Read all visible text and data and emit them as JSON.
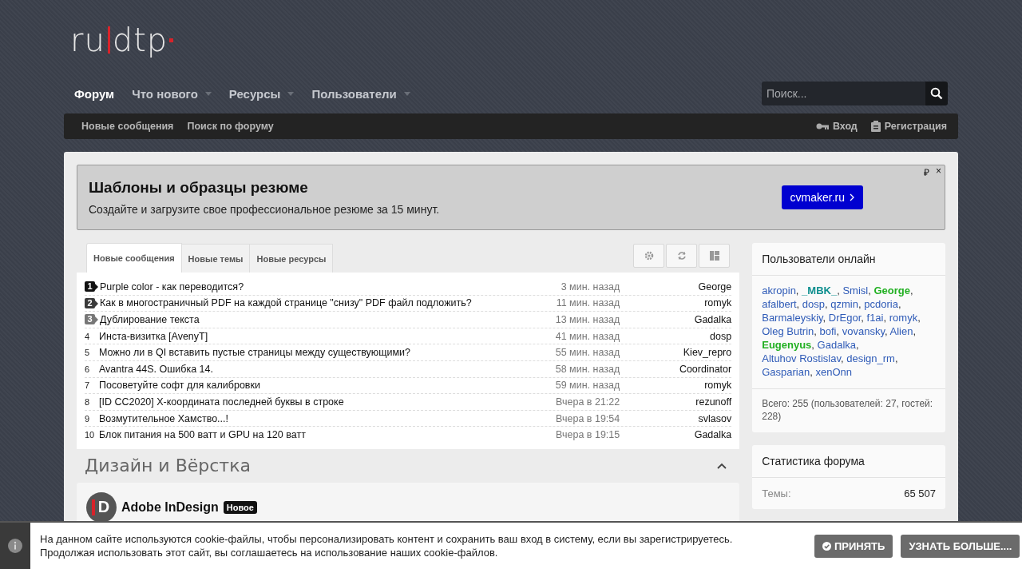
{
  "logo": {
    "left": "ru",
    "right": "dtp"
  },
  "nav": [
    {
      "label": "Форум",
      "selected": true,
      "dropdown": false
    },
    {
      "label": "Что нового",
      "selected": false,
      "dropdown": true
    },
    {
      "label": "Ресурсы",
      "selected": false,
      "dropdown": true
    },
    {
      "label": "Пользователи",
      "selected": false,
      "dropdown": true
    }
  ],
  "search": {
    "placeholder": "Поиск..."
  },
  "subnav": {
    "links": [
      "Новые сообщения",
      "Поиск по форуму"
    ],
    "login": "Вход",
    "register": "Регистрация"
  },
  "ad": {
    "title": "Шаблоны и образцы резюме",
    "text": "Создайте и загрузите свое профессиональное резюме за 15 минут.",
    "button": "cvmaker.ru",
    "mark": "₽",
    "close": "×"
  },
  "tabs": [
    {
      "label": "Новые сообщения",
      "selected": true
    },
    {
      "label": "Новые темы",
      "selected": false
    },
    {
      "label": "Новые ресурсы",
      "selected": false
    }
  ],
  "topics": [
    {
      "rank": "1",
      "kind": "ranked",
      "color": "#111111",
      "title": "Purple color - как переводится?",
      "time": "3 мин. назад",
      "user": "George"
    },
    {
      "rank": "2",
      "kind": "ranked",
      "color": "#3a3a3a",
      "title": "Как в многостраничный PDF на каждой странице \"снизу\" PDF файл подложить?",
      "time": "11 мин. назад",
      "user": "romyk"
    },
    {
      "rank": "3",
      "kind": "ranked",
      "color": "#777777",
      "title": "Дублирование текста",
      "time": "13 мин. назад",
      "user": "Gadalka"
    },
    {
      "rank": "4",
      "kind": "plain",
      "title": "Инста-визитка [AvenyT]",
      "time": "41 мин. назад",
      "user": "dosp"
    },
    {
      "rank": "5",
      "kind": "plain",
      "title": "Можно ли в QI вставить пустые страницы между существующими?",
      "time": "55 мин. назад",
      "user": "Kiev_repro"
    },
    {
      "rank": "6",
      "kind": "plain",
      "title": "Avantra 44S. Ошибка 14.",
      "time": "58 мин. назад",
      "user": "Coordinator"
    },
    {
      "rank": "7",
      "kind": "plain",
      "title": "Посоветуйте софт для калибровки",
      "time": "59 мин. назад",
      "user": "romyk"
    },
    {
      "rank": "8",
      "kind": "plain",
      "title": "[ID CC2020]  X-координата последней буквы в строке",
      "time": "Вчера в 21:22",
      "user": "rezunoff"
    },
    {
      "rank": "9",
      "kind": "plain",
      "title": "Возмутительное Хамство...!",
      "time": "Вчера в 19:54",
      "user": "svlasov"
    },
    {
      "rank": "10",
      "kind": "plain",
      "title": "Блок питания на 500 ватт и GPU на 120 ватт",
      "time": "Вчера в 19:15",
      "user": "Gadalka"
    }
  ],
  "section": {
    "title": "Дизайн и Вёрстка",
    "expanded": true,
    "forum": {
      "title": "Adobe InDesign",
      "badge": "Новое",
      "icon_letter": "D"
    }
  },
  "online": {
    "title": "Пользователи онлайн",
    "users": [
      {
        "name": "akropin",
        "color": "#2f5bb7"
      },
      {
        "name": "_MBK_",
        "color": "#0e8f8f"
      },
      {
        "name": "Smisl",
        "color": "#2f5bb7"
      },
      {
        "name": "George",
        "color": "#22b022"
      },
      {
        "name": "afalbert",
        "color": "#2f5bb7"
      },
      {
        "name": "dosp",
        "color": "#2f5bb7"
      },
      {
        "name": "qzmin",
        "color": "#2f5bb7"
      },
      {
        "name": "pcdoria",
        "color": "#2f5bb7"
      },
      {
        "name": "Barmaleyskiy",
        "color": "#2f5bb7"
      },
      {
        "name": "DrEgor",
        "color": "#2f5bb7"
      },
      {
        "name": "f1ai",
        "color": "#2f5bb7"
      },
      {
        "name": "romyk",
        "color": "#2f5bb7"
      },
      {
        "name": "Oleg Butrin",
        "color": "#2f5bb7"
      },
      {
        "name": "bofi",
        "color": "#2f5bb7"
      },
      {
        "name": "vovansky",
        "color": "#2f5bb7"
      },
      {
        "name": "Alien",
        "color": "#2f5bb7"
      },
      {
        "name": "Eugenyus",
        "color": "#22b022"
      },
      {
        "name": "Gadalka",
        "color": "#2f5bb7"
      },
      {
        "name": "Altuhov Rostislav",
        "color": "#2f5bb7"
      },
      {
        "name": "design_rm",
        "color": "#2f5bb7"
      },
      {
        "name": "Gasparian",
        "color": "#2f5bb7"
      },
      {
        "name": "xenOnn",
        "color": "#2f5bb7"
      }
    ],
    "separator": ",",
    "total": "Всего: 255 (пользователей: 27, гостей: 228)"
  },
  "stats": {
    "title": "Статистика форума",
    "rows": [
      {
        "label": "Темы:",
        "value": "65 507"
      }
    ]
  },
  "cookie": {
    "lines": [
      "На данном сайте используются cookie-файлы, чтобы персонализировать контент и сохранить ваш вход в систему, если вы зарегистрируетесь.",
      "Продолжая использовать этот сайт, вы соглашаетесь на использование наших cookie-файлов."
    ],
    "accept": "ПРИНЯТЬ",
    "more": "УЗНАТЬ БОЛЬШЕ...."
  }
}
